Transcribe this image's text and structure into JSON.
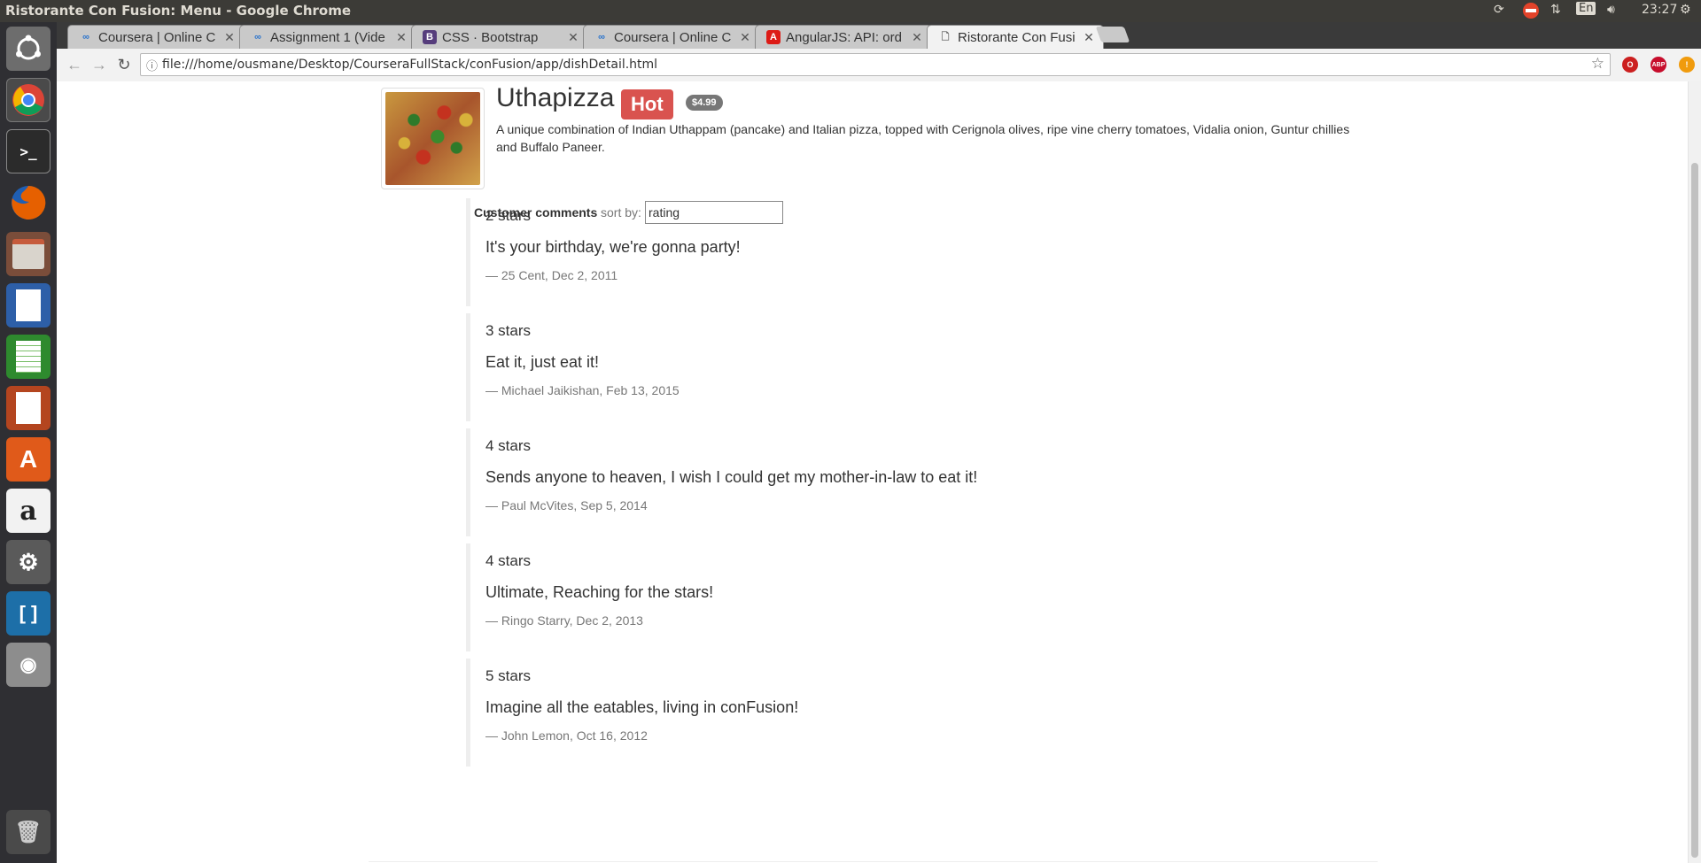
{
  "window": {
    "title": "Ristorante Con Fusion: Menu - Google Chrome"
  },
  "system_tray": {
    "language": "En",
    "clock": "23:27"
  },
  "launcher": {
    "items": [
      "Ubuntu Dash",
      "Google Chrome",
      "Terminal",
      "Firefox",
      "Files",
      "LibreOffice Writer",
      "LibreOffice Calc",
      "LibreOffice Impress",
      "Ubuntu Software",
      "Amazon",
      "System Settings",
      "Brackets",
      "Screenshot",
      "Trash"
    ]
  },
  "browser": {
    "tabs": [
      {
        "label": "Coursera | Online C",
        "icon": "coursera-icon"
      },
      {
        "label": "Assignment 1 (Vide",
        "icon": "coursera-icon"
      },
      {
        "label": "CSS · Bootstrap",
        "icon": "bootstrap-icon"
      },
      {
        "label": "Coursera | Online C",
        "icon": "coursera-icon"
      },
      {
        "label": "AngularJS: API: ord",
        "icon": "angular-icon"
      },
      {
        "label": "Ristorante Con Fusi",
        "icon": "page-icon"
      }
    ],
    "url": "file:///home/ousmane/Desktop/CourseraFullStack/conFusion/app/dishDetail.html"
  },
  "dish": {
    "name": "Uthapizza",
    "label": "Hot",
    "price": "$4.99",
    "description": "A unique combination of Indian Uthappam (pancake) and Italian pizza, topped with Cerignola olives, ripe vine cherry tomatoes, Vidalia onion, Guntur chillies and Buffalo Paneer."
  },
  "comments": {
    "heading": "Customer comments",
    "sort_label": "sort by:",
    "sort_value": "rating",
    "items": [
      {
        "stars": "2 stars",
        "text": "It's your birthday, we're gonna party!",
        "footer": "— 25 Cent, Dec 2, 2011"
      },
      {
        "stars": "3 stars",
        "text": "Eat it, just eat it!",
        "footer": "— Michael Jaikishan, Feb 13, 2015"
      },
      {
        "stars": "4 stars",
        "text": "Sends anyone to heaven, I wish I could get my mother-in-law to eat it!",
        "footer": "— Paul McVites, Sep 5, 2014"
      },
      {
        "stars": "4 stars",
        "text": "Ultimate, Reaching for the stars!",
        "footer": "— Ringo Starry, Dec 2, 2013"
      },
      {
        "stars": "5 stars",
        "text": "Imagine all the eatables, living in conFusion!",
        "footer": "— John Lemon, Oct 16, 2012"
      }
    ]
  },
  "colors": {
    "hot_label": "#d9534f",
    "price_badge": "#777777",
    "text": "#333333",
    "muted": "#777777"
  }
}
